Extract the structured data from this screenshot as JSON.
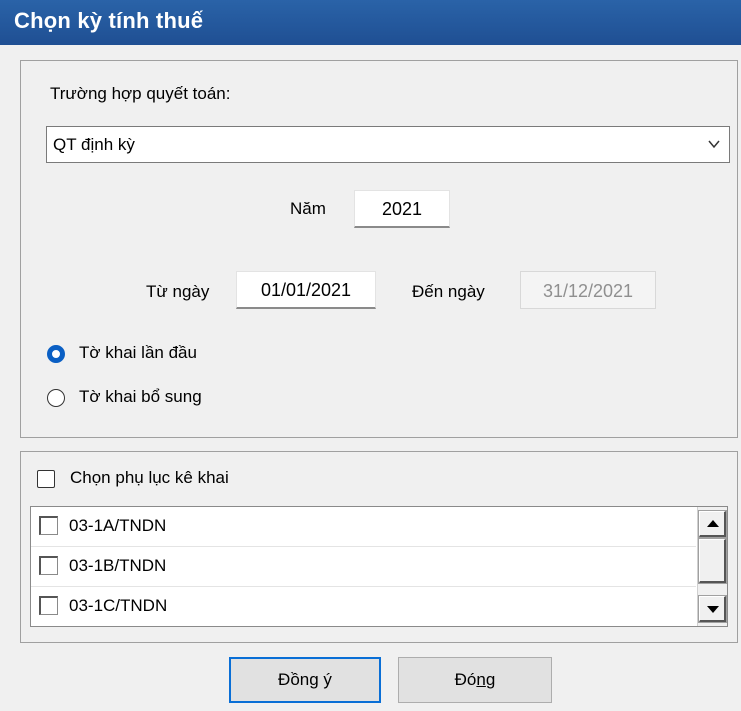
{
  "window": {
    "title": "Chọn kỳ tính thuế"
  },
  "settlement": {
    "label": "Trường hợp quyết toán:",
    "selected": "QT định kỳ"
  },
  "year": {
    "label": "Năm",
    "value": "2021"
  },
  "from_date": {
    "label": "Từ ngày",
    "value": "01/01/2021"
  },
  "to_date": {
    "label": "Đến ngày",
    "value": "31/12/2021"
  },
  "declaration_type": {
    "options": [
      {
        "label": "Tờ khai lần đầu",
        "checked": true
      },
      {
        "label": "Tờ khai bổ sung",
        "checked": false
      }
    ]
  },
  "appendix": {
    "label": "Chọn phụ lục kê khai",
    "checked": false,
    "items": [
      {
        "label": "03-1A/TNDN",
        "checked": false
      },
      {
        "label": "03-1B/TNDN",
        "checked": false
      },
      {
        "label": "03-1C/TNDN",
        "checked": false
      }
    ]
  },
  "buttons": {
    "ok": {
      "pre": "Đồn",
      "mnemonic": "g",
      "post": " ý"
    },
    "close": {
      "pre": "Đó",
      "mnemonic": "n",
      "post": "g"
    }
  },
  "colors": {
    "titlebar": "#1f4f93",
    "accent": "#0a5fc4",
    "default_button_border": "#0a6fd6"
  }
}
